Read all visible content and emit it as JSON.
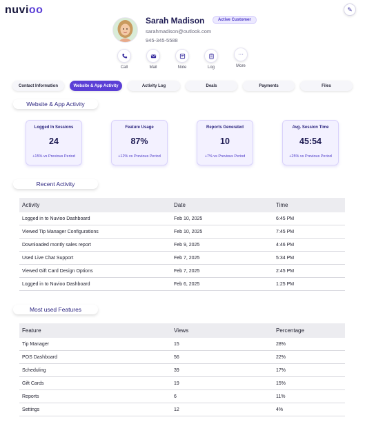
{
  "app": {
    "logo": "nuvioo"
  },
  "profile": {
    "name": "Sarah Madison",
    "status_badge": "Active Customer",
    "email": "sarahmadison@outlook.com",
    "phone": "945-345-5588"
  },
  "actions": [
    {
      "label": "Call",
      "icon": "phone-icon"
    },
    {
      "label": "Mail",
      "icon": "mail-icon"
    },
    {
      "label": "Note",
      "icon": "note-icon"
    },
    {
      "label": "Log",
      "icon": "clipboard-icon"
    },
    {
      "label": "More",
      "icon": "more-icon"
    }
  ],
  "tabs": [
    {
      "label": "Contact Information"
    },
    {
      "label": "Website & App Activity"
    },
    {
      "label": "Activity Log"
    },
    {
      "label": "Deals"
    },
    {
      "label": "Payments"
    },
    {
      "label": "Files"
    }
  ],
  "active_tab": "Website & App Activity",
  "section_title": "Website & App Activity",
  "metrics": [
    {
      "title": "Logged In Sessions",
      "value": "24",
      "change": "+15% vs  Previous Period"
    },
    {
      "title": "Feature Usage",
      "value": "87%",
      "change": "+12% vs  Previous Period"
    },
    {
      "title": "Reports Generated",
      "value": "10",
      "change": "+7% vs  Previous Period"
    },
    {
      "title": "Avg. Session Time",
      "value": "45:54",
      "change": "+25% vs  Previous Period"
    }
  ],
  "recent_activity": {
    "title": "Recent Activity",
    "columns": [
      "Activity",
      "Date",
      "Time"
    ],
    "rows": [
      [
        "Logged in to Nuvioo Dashboard",
        "Feb 10, 2025",
        "6:45 PM"
      ],
      [
        "Viewed Tip Manager Configurations",
        "Feb 10, 2025",
        "7:45 PM"
      ],
      [
        "Downloaded montly sales report",
        "Feb 9, 2025",
        "4:46 PM"
      ],
      [
        "Used Live Chat Support",
        "Feb 7, 2025",
        "5:34 PM"
      ],
      [
        "Viewed Gift Card Design Options",
        "Feb 7, 2025",
        "2:45 PM"
      ],
      [
        "Logged in to Nuvioo Dashboard",
        "Feb 6, 2025",
        "1:25 PM"
      ]
    ]
  },
  "features": {
    "title": "Most used Features",
    "columns": [
      "Feature",
      "Views",
      "Percentage"
    ],
    "rows": [
      [
        "Tip Manager",
        "15",
        "28%"
      ],
      [
        "POS Dashboard",
        "56",
        "22%"
      ],
      [
        "Scheduling",
        "39",
        "17%"
      ],
      [
        "Gift Cards",
        "19",
        "15%"
      ],
      [
        "Reports",
        "6",
        "11%"
      ],
      [
        "Settings",
        "12",
        "4%"
      ]
    ]
  },
  "colors": {
    "accent": "#5b3fd6",
    "card_bg": "#f3f1ff"
  }
}
